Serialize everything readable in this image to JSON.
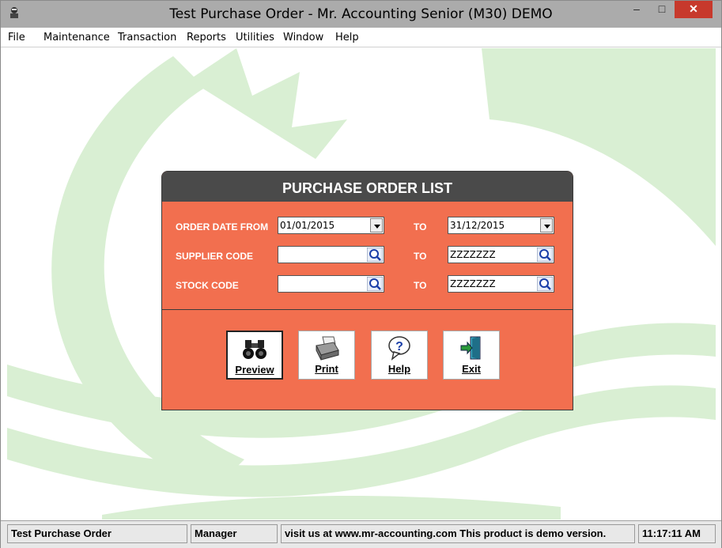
{
  "window": {
    "title": "Test Purchase Order - Mr. Accounting Senior (M30) DEMO",
    "minimize_glyph": "–",
    "maximize_glyph": "□",
    "close_glyph": "✕"
  },
  "menu": [
    {
      "label": "File"
    },
    {
      "label": "Maintenance"
    },
    {
      "label": "Transaction"
    },
    {
      "label": "Reports"
    },
    {
      "label": "Utilities"
    },
    {
      "label": "Window"
    },
    {
      "label": "Help"
    }
  ],
  "form": {
    "title": "PURCHASE ORDER LIST",
    "rows": [
      {
        "label": "ORDER DATE FROM",
        "from": "01/01/2015",
        "to_label": "TO",
        "to": "31/12/2015",
        "control": "dropdown"
      },
      {
        "label": "SUPPLIER CODE",
        "from": "",
        "to_label": "TO",
        "to": "ZZZZZZZ",
        "control": "search"
      },
      {
        "label": "STOCK CODE",
        "from": "",
        "to_label": "TO",
        "to": "ZZZZZZZ",
        "control": "search"
      }
    ],
    "buttons": [
      {
        "label": "Preview",
        "icon": "binoculars-icon"
      },
      {
        "label": "Print",
        "icon": "printer-icon"
      },
      {
        "label": "Help",
        "icon": "help-icon"
      },
      {
        "label": "Exit",
        "icon": "exit-door-icon"
      }
    ]
  },
  "status": {
    "module": "Test Purchase Order",
    "user": "Manager",
    "message": "visit us at www.mr-accounting.com This product is demo version.",
    "time": "11:17:11 AM"
  },
  "colors": {
    "titlebar": "#ababab",
    "panel_body": "#f26f4f",
    "panel_header": "#4a4a4a",
    "watermark": "#d9efd3",
    "close_button": "#c7392c"
  }
}
